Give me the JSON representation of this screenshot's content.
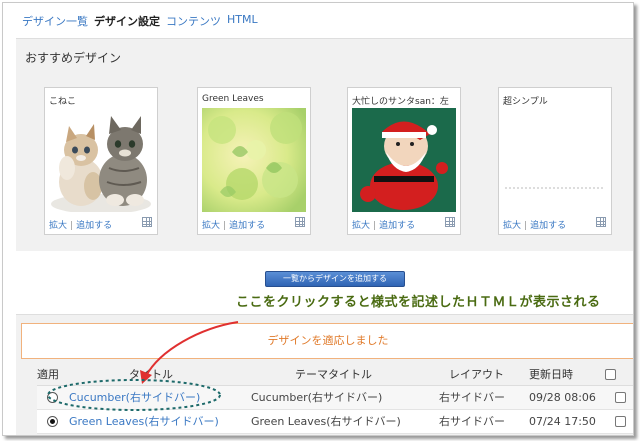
{
  "nav": {
    "items": [
      "デザイン一覧",
      "デザイン設定",
      "コンテンツ",
      "HTML"
    ],
    "active_index": 1
  },
  "recommended": {
    "title": "おすすめデザイン",
    "cards": [
      {
        "name": "こねこ",
        "zoom": "拡大",
        "add": "追加する"
      },
      {
        "name": "Green Leaves",
        "zoom": "拡大",
        "add": "追加する"
      },
      {
        "name": "大忙しのサンタsan：左",
        "zoom": "拡大",
        "add": "追加する"
      },
      {
        "name": "超シンプル",
        "zoom": "拡大",
        "add": "追加する"
      }
    ]
  },
  "add_button_label": "一覧からデザインを追加する",
  "callout": "ここをクリックすると様式を記述したＨＴＭＬが表示される",
  "applied": {
    "notice": "デザインを適応しました",
    "headers": {
      "apply": "適用",
      "title": "タイトル",
      "theme": "テーマタイトル",
      "layout": "レイアウト",
      "updated": "更新日時"
    },
    "rows": [
      {
        "title": "Cucumber(右サイドバー)",
        "theme": "Cucumber(右サイドバー)",
        "layout": "右サイドバー",
        "updated": "09/28 08:06",
        "selected": false
      },
      {
        "title": "Green Leaves(右サイドバー)",
        "theme": "Green Leaves(右サイドバー)",
        "layout": "右サイドバー",
        "updated": "07/24 17:50",
        "selected": true
      }
    ]
  },
  "colors": {
    "link": "#3a78c3",
    "callout": "#4a6b12",
    "notice": "#e07a2a",
    "arrow": "#e03030",
    "ellipse": "#1d6a6a"
  }
}
